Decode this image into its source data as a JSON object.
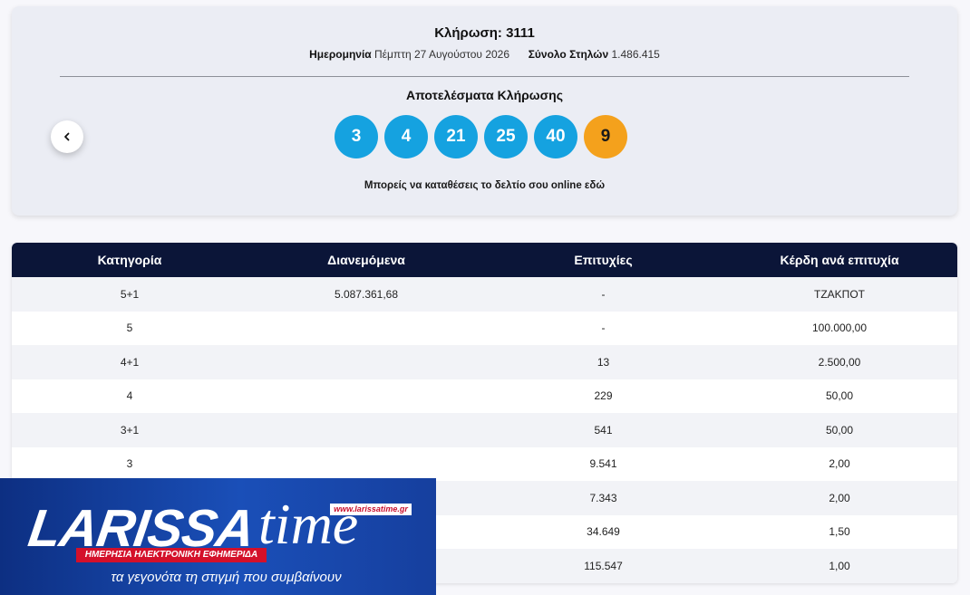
{
  "draw": {
    "title": "Κλήρωση: 3111",
    "date_label": "Ημερομηνία",
    "date_value": "Πέμπτη 27 Αυγούστου 2026",
    "columns_label": "Σύνολο Στηλών",
    "columns_value": "1.486.415",
    "results_title": "Αποτελέσματα Κλήρωσης",
    "numbers": [
      "3",
      "4",
      "21",
      "25",
      "40"
    ],
    "bonus": "9",
    "online_text": "Μπορείς να καταθέσεις το δελτίο σου online εδώ"
  },
  "colors": {
    "ball": "#15a2e0",
    "bonus_ball": "#f4a11c",
    "table_header": "#0b1538"
  },
  "icons": {
    "prev": "chevron-left-icon"
  },
  "table": {
    "headers": [
      "Κατηγορία",
      "Διανεμόμενα",
      "Επιτυχίες",
      "Κέρδη ανά επιτυχία"
    ],
    "rows": [
      [
        "5+1",
        "5.087.361,68",
        "-",
        "ΤΖΑΚΠΟΤ"
      ],
      [
        "5",
        "",
        "-",
        "100.000,00"
      ],
      [
        "4+1",
        "",
        "13",
        "2.500,00"
      ],
      [
        "4",
        "",
        "229",
        "50,00"
      ],
      [
        "3+1",
        "",
        "541",
        "50,00"
      ],
      [
        "3",
        "",
        "9.541",
        "2,00"
      ],
      [
        "",
        "",
        "7.343",
        "2,00"
      ],
      [
        "",
        "",
        "34.649",
        "1,50"
      ],
      [
        "",
        "",
        "115.547",
        "1,00"
      ]
    ]
  },
  "watermark": {
    "logo_main": "LARISSA",
    "logo_script": "time",
    "url": "www.larissatime.gr",
    "band": "ΗΜΕΡΗΣΙΑ ΗΛΕΚΤΡΟΝΙΚΗ ΕΦΗΜΕΡΙΔΑ",
    "tagline": "τα γεγονότα τη στιγμή που συμβαίνουν"
  }
}
